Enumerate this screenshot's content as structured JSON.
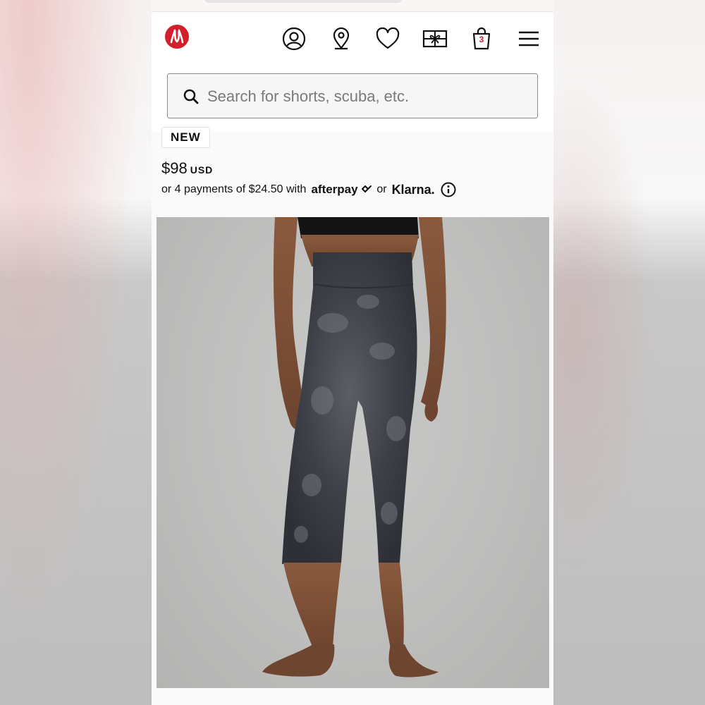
{
  "header": {
    "logo_name": "lululemon-logo",
    "icons": [
      "account-icon",
      "store-locator-icon",
      "wishlist-icon",
      "gift-card-icon",
      "shopping-bag-icon",
      "menu-icon"
    ],
    "bag_count": "3"
  },
  "search": {
    "placeholder": "Search for shorts, scuba, etc.",
    "value": ""
  },
  "product": {
    "badge": "NEW",
    "price": "$98",
    "currency": "USD",
    "installments_text": "or 4 payments of $24.50 with",
    "afterpay_label": "afterpay",
    "or_label": "or",
    "klarna_label": "Klarna.",
    "image_alt": "Woman wearing grey tie-dye high-rise crop leggings"
  },
  "colors": {
    "brand_red": "#d31f2c",
    "text": "#111111"
  }
}
